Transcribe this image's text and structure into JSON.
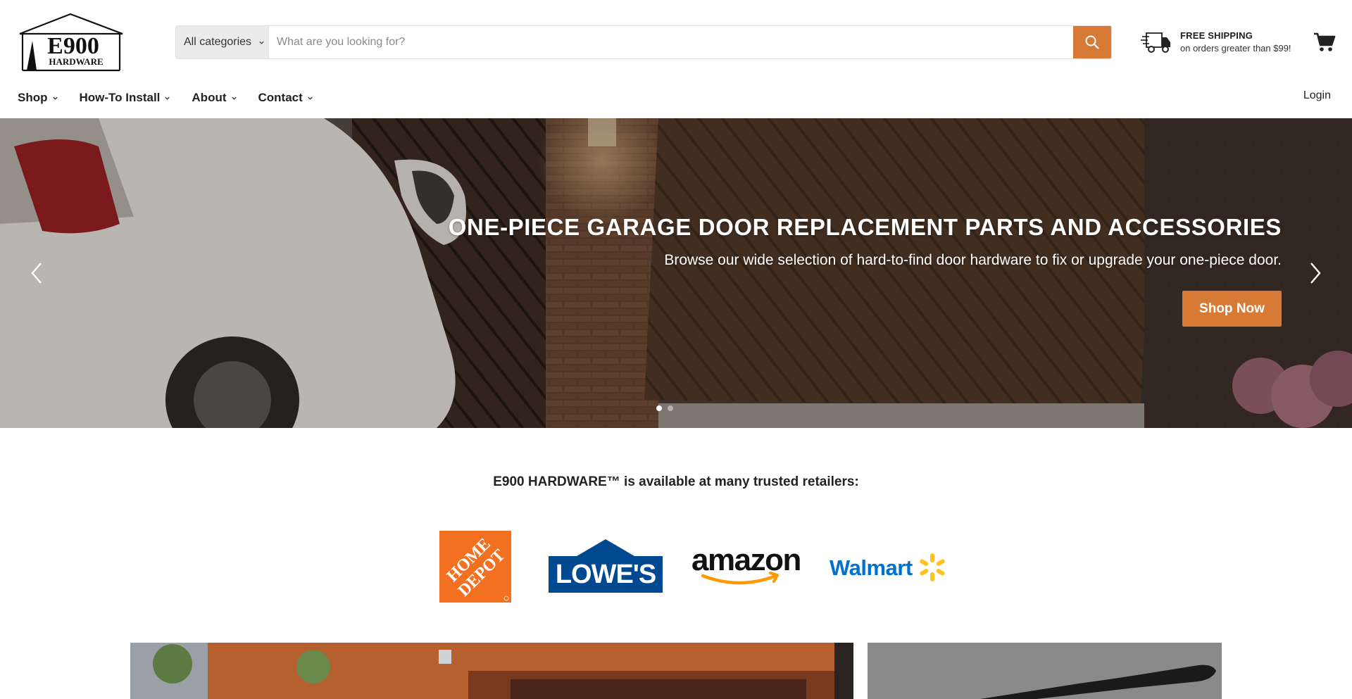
{
  "header": {
    "logo_text": "E900",
    "logo_subtext": "HARDWARE",
    "search": {
      "category_label": "All categories",
      "placeholder": "What are you looking for?",
      "value": ""
    },
    "shipping": {
      "title": "FREE SHIPPING",
      "subtitle": "on orders greater than $99!"
    },
    "nav": [
      {
        "label": "Shop"
      },
      {
        "label": "How-To Install"
      },
      {
        "label": "About"
      },
      {
        "label": "Contact"
      }
    ],
    "login_label": "Login"
  },
  "hero": {
    "title": "ONE-PIECE GARAGE DOOR REPLACEMENT PARTS AND ACCESSORIES",
    "subtitle": "Browse our wide selection of hard-to-find door hardware to fix or upgrade your one-piece door.",
    "cta_label": "Shop Now",
    "slide_count": 2,
    "active_slide": 1
  },
  "retailers": {
    "heading": "E900 HARDWARE™ is available at many trusted retailers:",
    "items": [
      {
        "name": "HOME DEPOT",
        "lines": [
          "HOME",
          "DEPOT"
        ]
      },
      {
        "name": "LOWE'S",
        "label": "LOWE'S"
      },
      {
        "name": "amazon",
        "label": "amazon"
      },
      {
        "name": "Walmart",
        "label": "Walmart"
      }
    ]
  },
  "colors": {
    "accent": "#d67a35",
    "home_depot": "#f37021",
    "lowes": "#004990",
    "walmart_blue": "#0071ce",
    "walmart_spark": "#ffc220",
    "amazon_orange": "#ff9900"
  }
}
